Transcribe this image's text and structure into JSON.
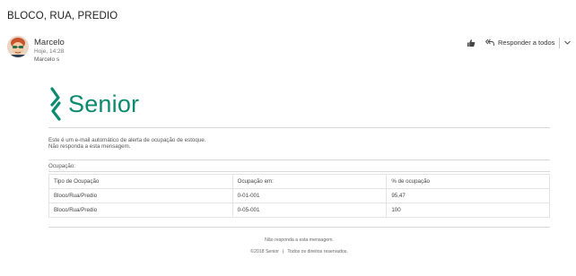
{
  "email": {
    "subject": "BLOCO, RUA, PREDIO",
    "sender_name": "Marcelo",
    "time": "Hoje, 14:28",
    "to": "Marcelo s"
  },
  "actions": {
    "like_icon": "thumbs-up-icon",
    "reply_all_label": "Responder a todos",
    "reply_icon": "reply-all-icon",
    "chevron_icon": "chevron-down-icon"
  },
  "body": {
    "logo_text": "Senior",
    "brand_color": "#0b8a6f",
    "intro_line1": "Este é um e-mail automático de alerta de ocupação de estoque.",
    "intro_line2": "Não responda a esta mensagem.",
    "occupation_label": "Ocupação:",
    "table": {
      "headers": [
        "Tipo de Ocupação",
        "Ocupação em:",
        "% de ocupação"
      ],
      "rows": [
        [
          "Bloco/Rua/Predio",
          "0-01-001",
          "95,47"
        ],
        [
          "Bloco/Rua/Predio",
          "0-05-001",
          "100"
        ]
      ]
    },
    "footer_note": "Não responda a esta mensagem.",
    "footer_copyright": "©2018 Senior",
    "footer_rights": "Todos os direitos reservados."
  }
}
